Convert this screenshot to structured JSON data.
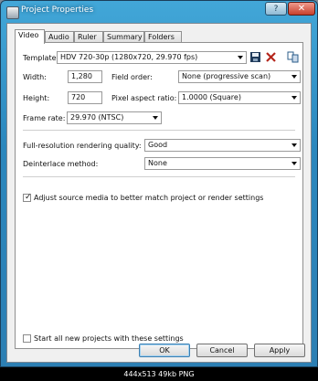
{
  "window": {
    "title": "Project Properties",
    "help_label": "?",
    "close_label": "✕"
  },
  "tabs": [
    {
      "label": "Video",
      "active": true
    },
    {
      "label": "Audio",
      "active": false
    },
    {
      "label": "Ruler",
      "active": false
    },
    {
      "label": "Summary",
      "active": false
    },
    {
      "label": "Folders",
      "active": false
    }
  ],
  "video": {
    "template_label": "Template:",
    "template_value": "HDV 720-30p (1280x720, 29.970 fps)",
    "width_label": "Width:",
    "width_value": "1,280",
    "height_label": "Height:",
    "height_value": "720",
    "field_order_label": "Field order:",
    "field_order_value": "None (progressive scan)",
    "pixel_aspect_label": "Pixel aspect ratio:",
    "pixel_aspect_value": "1.0000 (Square)",
    "frame_rate_label": "Frame rate:",
    "frame_rate_value": "29.970 (NTSC)",
    "render_quality_label": "Full-resolution rendering quality:",
    "render_quality_value": "Good",
    "deinterlace_label": "Deinterlace method:",
    "deinterlace_value": "None",
    "adjust_source_label": "Adjust source media to better match project or render settings",
    "adjust_source_checked": true,
    "start_all_label": "Start all new projects with these settings",
    "start_all_checked": false
  },
  "icons": {
    "save": "save-disk-icon",
    "delete": "delete-x-icon",
    "match_media": "match-media-icon"
  },
  "buttons": {
    "ok": "OK",
    "cancel": "Cancel",
    "apply": "Apply"
  },
  "caption": "444x513 49kb PNG"
}
